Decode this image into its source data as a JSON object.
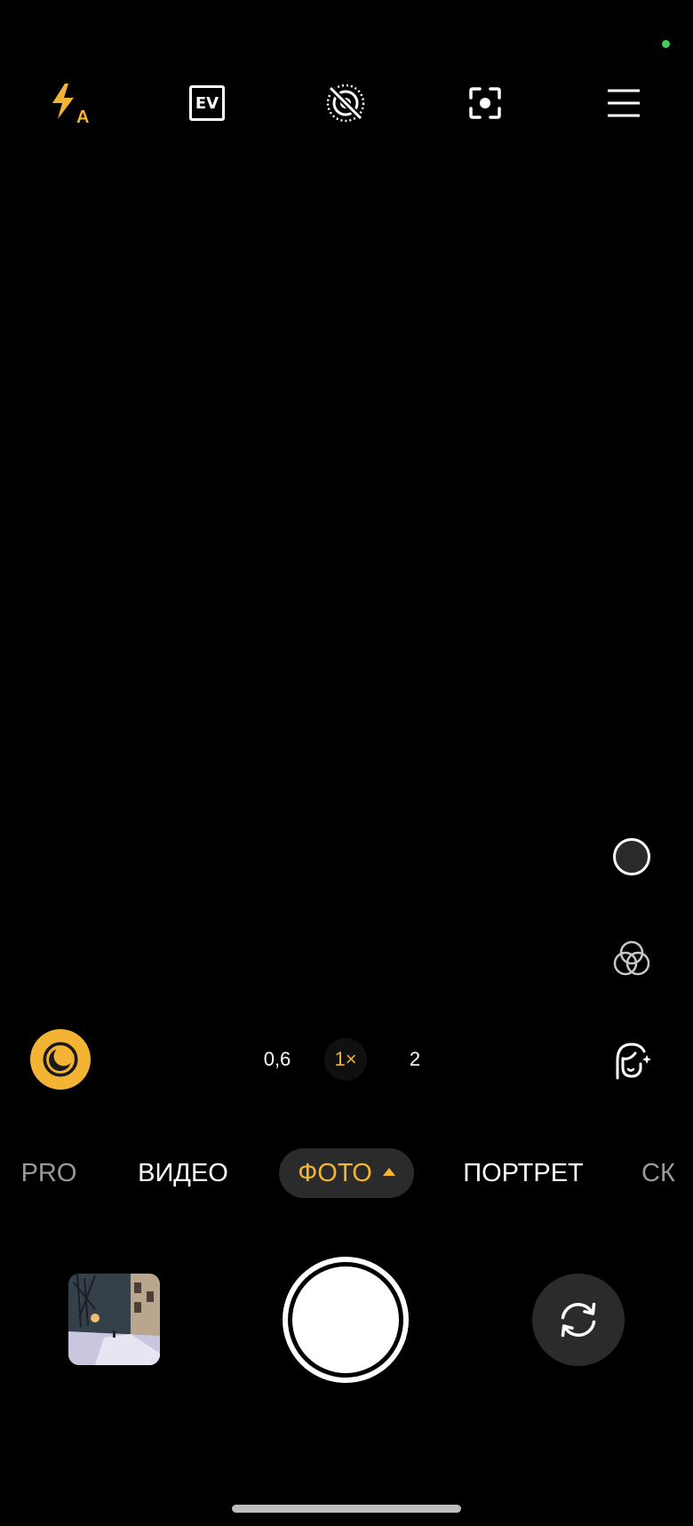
{
  "top_bar": {
    "flash_mode_label": "A",
    "ev_label": "EV"
  },
  "zoom": {
    "options": [
      "0,6",
      "1×",
      "2"
    ],
    "active_index": 1
  },
  "modes": {
    "items": [
      "PRO",
      "ВИДЕО",
      "ФОТО",
      "ПОРТРЕТ",
      "СК"
    ],
    "active": "ФОТО"
  },
  "colors": {
    "accent": "#f3b433",
    "privacy_dot": "#3ccf5a",
    "background": "#000000",
    "chip_bg": "#2b2b2b"
  },
  "icons": {
    "flash": "flash-auto-icon",
    "ev": "exposure-ev-icon",
    "live_photo_off": "live-photo-off-icon",
    "focus": "focus-frame-icon",
    "menu": "hamburger-menu-icon",
    "night": "night-mode-icon",
    "filter_circle": "circle-filter-icon",
    "color_filter": "color-filters-icon",
    "beauty": "face-beauty-icon",
    "flip": "camera-flip-icon"
  }
}
